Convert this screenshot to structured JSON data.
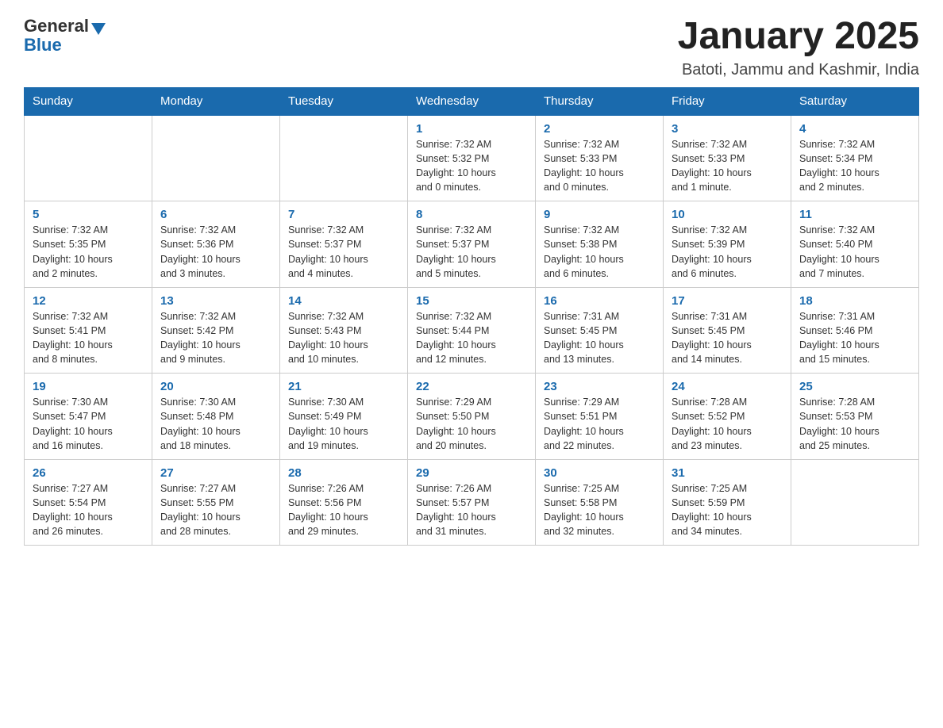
{
  "header": {
    "logo": {
      "general": "General",
      "blue": "Blue"
    },
    "title": "January 2025",
    "location": "Batoti, Jammu and Kashmir, India"
  },
  "calendar": {
    "days_of_week": [
      "Sunday",
      "Monday",
      "Tuesday",
      "Wednesday",
      "Thursday",
      "Friday",
      "Saturday"
    ],
    "weeks": [
      [
        {
          "day": "",
          "info": ""
        },
        {
          "day": "",
          "info": ""
        },
        {
          "day": "",
          "info": ""
        },
        {
          "day": "1",
          "info": "Sunrise: 7:32 AM\nSunset: 5:32 PM\nDaylight: 10 hours\nand 0 minutes."
        },
        {
          "day": "2",
          "info": "Sunrise: 7:32 AM\nSunset: 5:33 PM\nDaylight: 10 hours\nand 0 minutes."
        },
        {
          "day": "3",
          "info": "Sunrise: 7:32 AM\nSunset: 5:33 PM\nDaylight: 10 hours\nand 1 minute."
        },
        {
          "day": "4",
          "info": "Sunrise: 7:32 AM\nSunset: 5:34 PM\nDaylight: 10 hours\nand 2 minutes."
        }
      ],
      [
        {
          "day": "5",
          "info": "Sunrise: 7:32 AM\nSunset: 5:35 PM\nDaylight: 10 hours\nand 2 minutes."
        },
        {
          "day": "6",
          "info": "Sunrise: 7:32 AM\nSunset: 5:36 PM\nDaylight: 10 hours\nand 3 minutes."
        },
        {
          "day": "7",
          "info": "Sunrise: 7:32 AM\nSunset: 5:37 PM\nDaylight: 10 hours\nand 4 minutes."
        },
        {
          "day": "8",
          "info": "Sunrise: 7:32 AM\nSunset: 5:37 PM\nDaylight: 10 hours\nand 5 minutes."
        },
        {
          "day": "9",
          "info": "Sunrise: 7:32 AM\nSunset: 5:38 PM\nDaylight: 10 hours\nand 6 minutes."
        },
        {
          "day": "10",
          "info": "Sunrise: 7:32 AM\nSunset: 5:39 PM\nDaylight: 10 hours\nand 6 minutes."
        },
        {
          "day": "11",
          "info": "Sunrise: 7:32 AM\nSunset: 5:40 PM\nDaylight: 10 hours\nand 7 minutes."
        }
      ],
      [
        {
          "day": "12",
          "info": "Sunrise: 7:32 AM\nSunset: 5:41 PM\nDaylight: 10 hours\nand 8 minutes."
        },
        {
          "day": "13",
          "info": "Sunrise: 7:32 AM\nSunset: 5:42 PM\nDaylight: 10 hours\nand 9 minutes."
        },
        {
          "day": "14",
          "info": "Sunrise: 7:32 AM\nSunset: 5:43 PM\nDaylight: 10 hours\nand 10 minutes."
        },
        {
          "day": "15",
          "info": "Sunrise: 7:32 AM\nSunset: 5:44 PM\nDaylight: 10 hours\nand 12 minutes."
        },
        {
          "day": "16",
          "info": "Sunrise: 7:31 AM\nSunset: 5:45 PM\nDaylight: 10 hours\nand 13 minutes."
        },
        {
          "day": "17",
          "info": "Sunrise: 7:31 AM\nSunset: 5:45 PM\nDaylight: 10 hours\nand 14 minutes."
        },
        {
          "day": "18",
          "info": "Sunrise: 7:31 AM\nSunset: 5:46 PM\nDaylight: 10 hours\nand 15 minutes."
        }
      ],
      [
        {
          "day": "19",
          "info": "Sunrise: 7:30 AM\nSunset: 5:47 PM\nDaylight: 10 hours\nand 16 minutes."
        },
        {
          "day": "20",
          "info": "Sunrise: 7:30 AM\nSunset: 5:48 PM\nDaylight: 10 hours\nand 18 minutes."
        },
        {
          "day": "21",
          "info": "Sunrise: 7:30 AM\nSunset: 5:49 PM\nDaylight: 10 hours\nand 19 minutes."
        },
        {
          "day": "22",
          "info": "Sunrise: 7:29 AM\nSunset: 5:50 PM\nDaylight: 10 hours\nand 20 minutes."
        },
        {
          "day": "23",
          "info": "Sunrise: 7:29 AM\nSunset: 5:51 PM\nDaylight: 10 hours\nand 22 minutes."
        },
        {
          "day": "24",
          "info": "Sunrise: 7:28 AM\nSunset: 5:52 PM\nDaylight: 10 hours\nand 23 minutes."
        },
        {
          "day": "25",
          "info": "Sunrise: 7:28 AM\nSunset: 5:53 PM\nDaylight: 10 hours\nand 25 minutes."
        }
      ],
      [
        {
          "day": "26",
          "info": "Sunrise: 7:27 AM\nSunset: 5:54 PM\nDaylight: 10 hours\nand 26 minutes."
        },
        {
          "day": "27",
          "info": "Sunrise: 7:27 AM\nSunset: 5:55 PM\nDaylight: 10 hours\nand 28 minutes."
        },
        {
          "day": "28",
          "info": "Sunrise: 7:26 AM\nSunset: 5:56 PM\nDaylight: 10 hours\nand 29 minutes."
        },
        {
          "day": "29",
          "info": "Sunrise: 7:26 AM\nSunset: 5:57 PM\nDaylight: 10 hours\nand 31 minutes."
        },
        {
          "day": "30",
          "info": "Sunrise: 7:25 AM\nSunset: 5:58 PM\nDaylight: 10 hours\nand 32 minutes."
        },
        {
          "day": "31",
          "info": "Sunrise: 7:25 AM\nSunset: 5:59 PM\nDaylight: 10 hours\nand 34 minutes."
        },
        {
          "day": "",
          "info": ""
        }
      ]
    ]
  }
}
